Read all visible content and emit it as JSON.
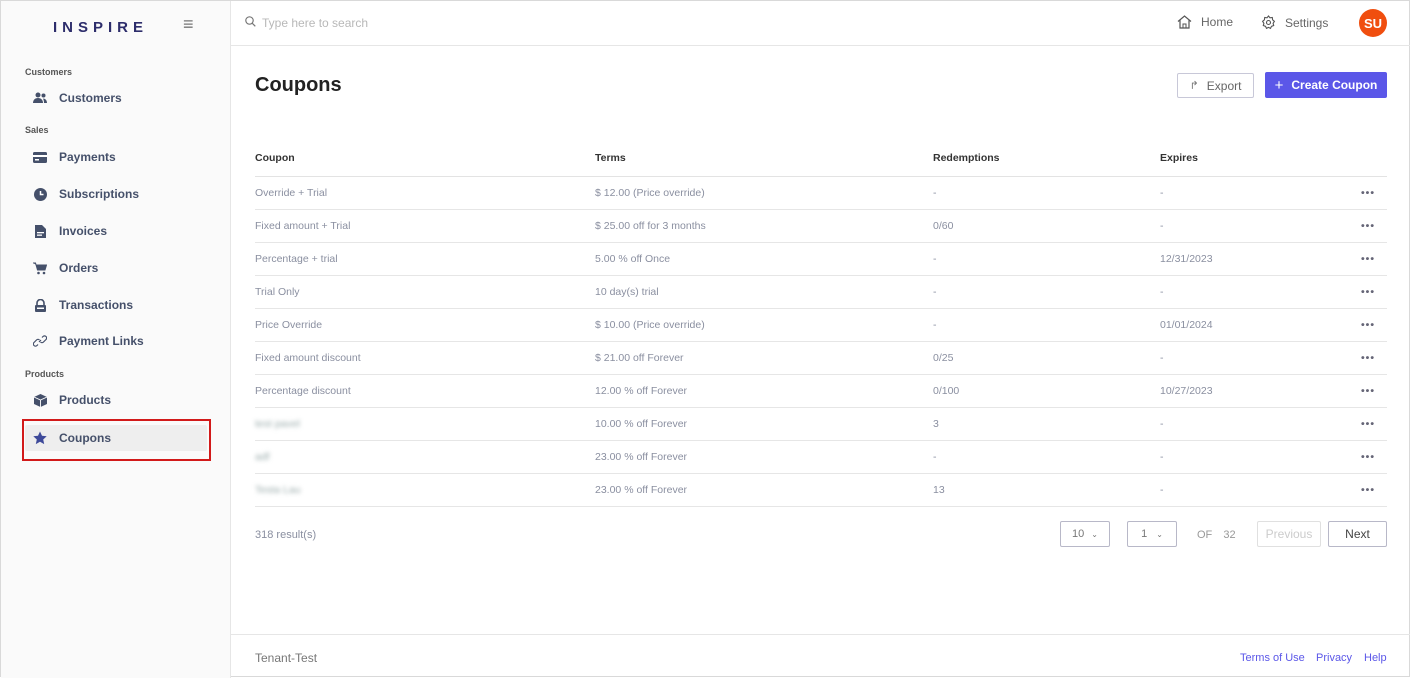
{
  "app": {
    "logo": "INSPIRE"
  },
  "sidebar": {
    "sections": [
      {
        "label": "Customers"
      },
      {
        "label": "Sales"
      },
      {
        "label": "Products"
      }
    ],
    "items": [
      {
        "label": "Customers",
        "icon": "users-icon"
      },
      {
        "label": "Payments",
        "icon": "credit-card-icon"
      },
      {
        "label": "Subscriptions",
        "icon": "clock-icon"
      },
      {
        "label": "Invoices",
        "icon": "document-icon"
      },
      {
        "label": "Orders",
        "icon": "cart-icon"
      },
      {
        "label": "Transactions",
        "icon": "lock-icon"
      },
      {
        "label": "Payment Links",
        "icon": "link-icon"
      },
      {
        "label": "Products",
        "icon": "box-icon"
      },
      {
        "label": "Coupons",
        "icon": "star-icon",
        "active": true
      }
    ]
  },
  "header": {
    "search_placeholder": "Type here to search",
    "home_label": "Home",
    "settings_label": "Settings",
    "avatar_initials": "SU",
    "avatar_color": "#f04e0f"
  },
  "main": {
    "title": "Coupons",
    "export_label": "Export",
    "create_label": "Create Coupon",
    "accent_color": "#5b57e8",
    "columns": [
      "Coupon",
      "Terms",
      "Redemptions",
      "Expires"
    ],
    "rows": [
      {
        "coupon": "Override + Trial",
        "terms": "$ 12.00 (Price override)",
        "redemptions": "-",
        "expires": "-"
      },
      {
        "coupon": "Fixed amount + Trial",
        "terms": "$ 25.00 off for 3 months",
        "redemptions": "0/60",
        "expires": "-"
      },
      {
        "coupon": "Percentage + trial",
        "terms": "5.00 % off Once",
        "redemptions": "-",
        "expires": "12/31/2023"
      },
      {
        "coupon": "Trial Only",
        "terms": "10 day(s) trial",
        "redemptions": "-",
        "expires": "-"
      },
      {
        "coupon": "Price Override",
        "terms": "$ 10.00 (Price override)",
        "redemptions": "-",
        "expires": "01/01/2024"
      },
      {
        "coupon": "Fixed amount discount",
        "terms": "$ 21.00 off Forever",
        "redemptions": "0/25",
        "expires": "-"
      },
      {
        "coupon": "Percentage discount",
        "terms": "12.00 % off Forever",
        "redemptions": "0/100",
        "expires": "10/27/2023"
      },
      {
        "coupon": "test pavel",
        "terms": "10.00 % off Forever",
        "redemptions": "3",
        "expires": "-",
        "blurred": true
      },
      {
        "coupon": "adf",
        "terms": "23.00 % off Forever",
        "redemptions": "-",
        "expires": "-",
        "blurred": true
      },
      {
        "coupon": "Testa Lau",
        "terms": "23.00 % off Forever",
        "redemptions": "13",
        "expires": "-",
        "blurred": true
      }
    ],
    "row_menu": "•••",
    "results": "318 result(s)",
    "pagination": {
      "page_size": "10",
      "page": "1",
      "of_label": "OF",
      "total_pages": "32",
      "previous_label": "Previous",
      "next_label": "Next"
    }
  },
  "footer": {
    "tenant": "Tenant-Test",
    "links": [
      "Terms of Use",
      "Privacy",
      "Help"
    ]
  }
}
